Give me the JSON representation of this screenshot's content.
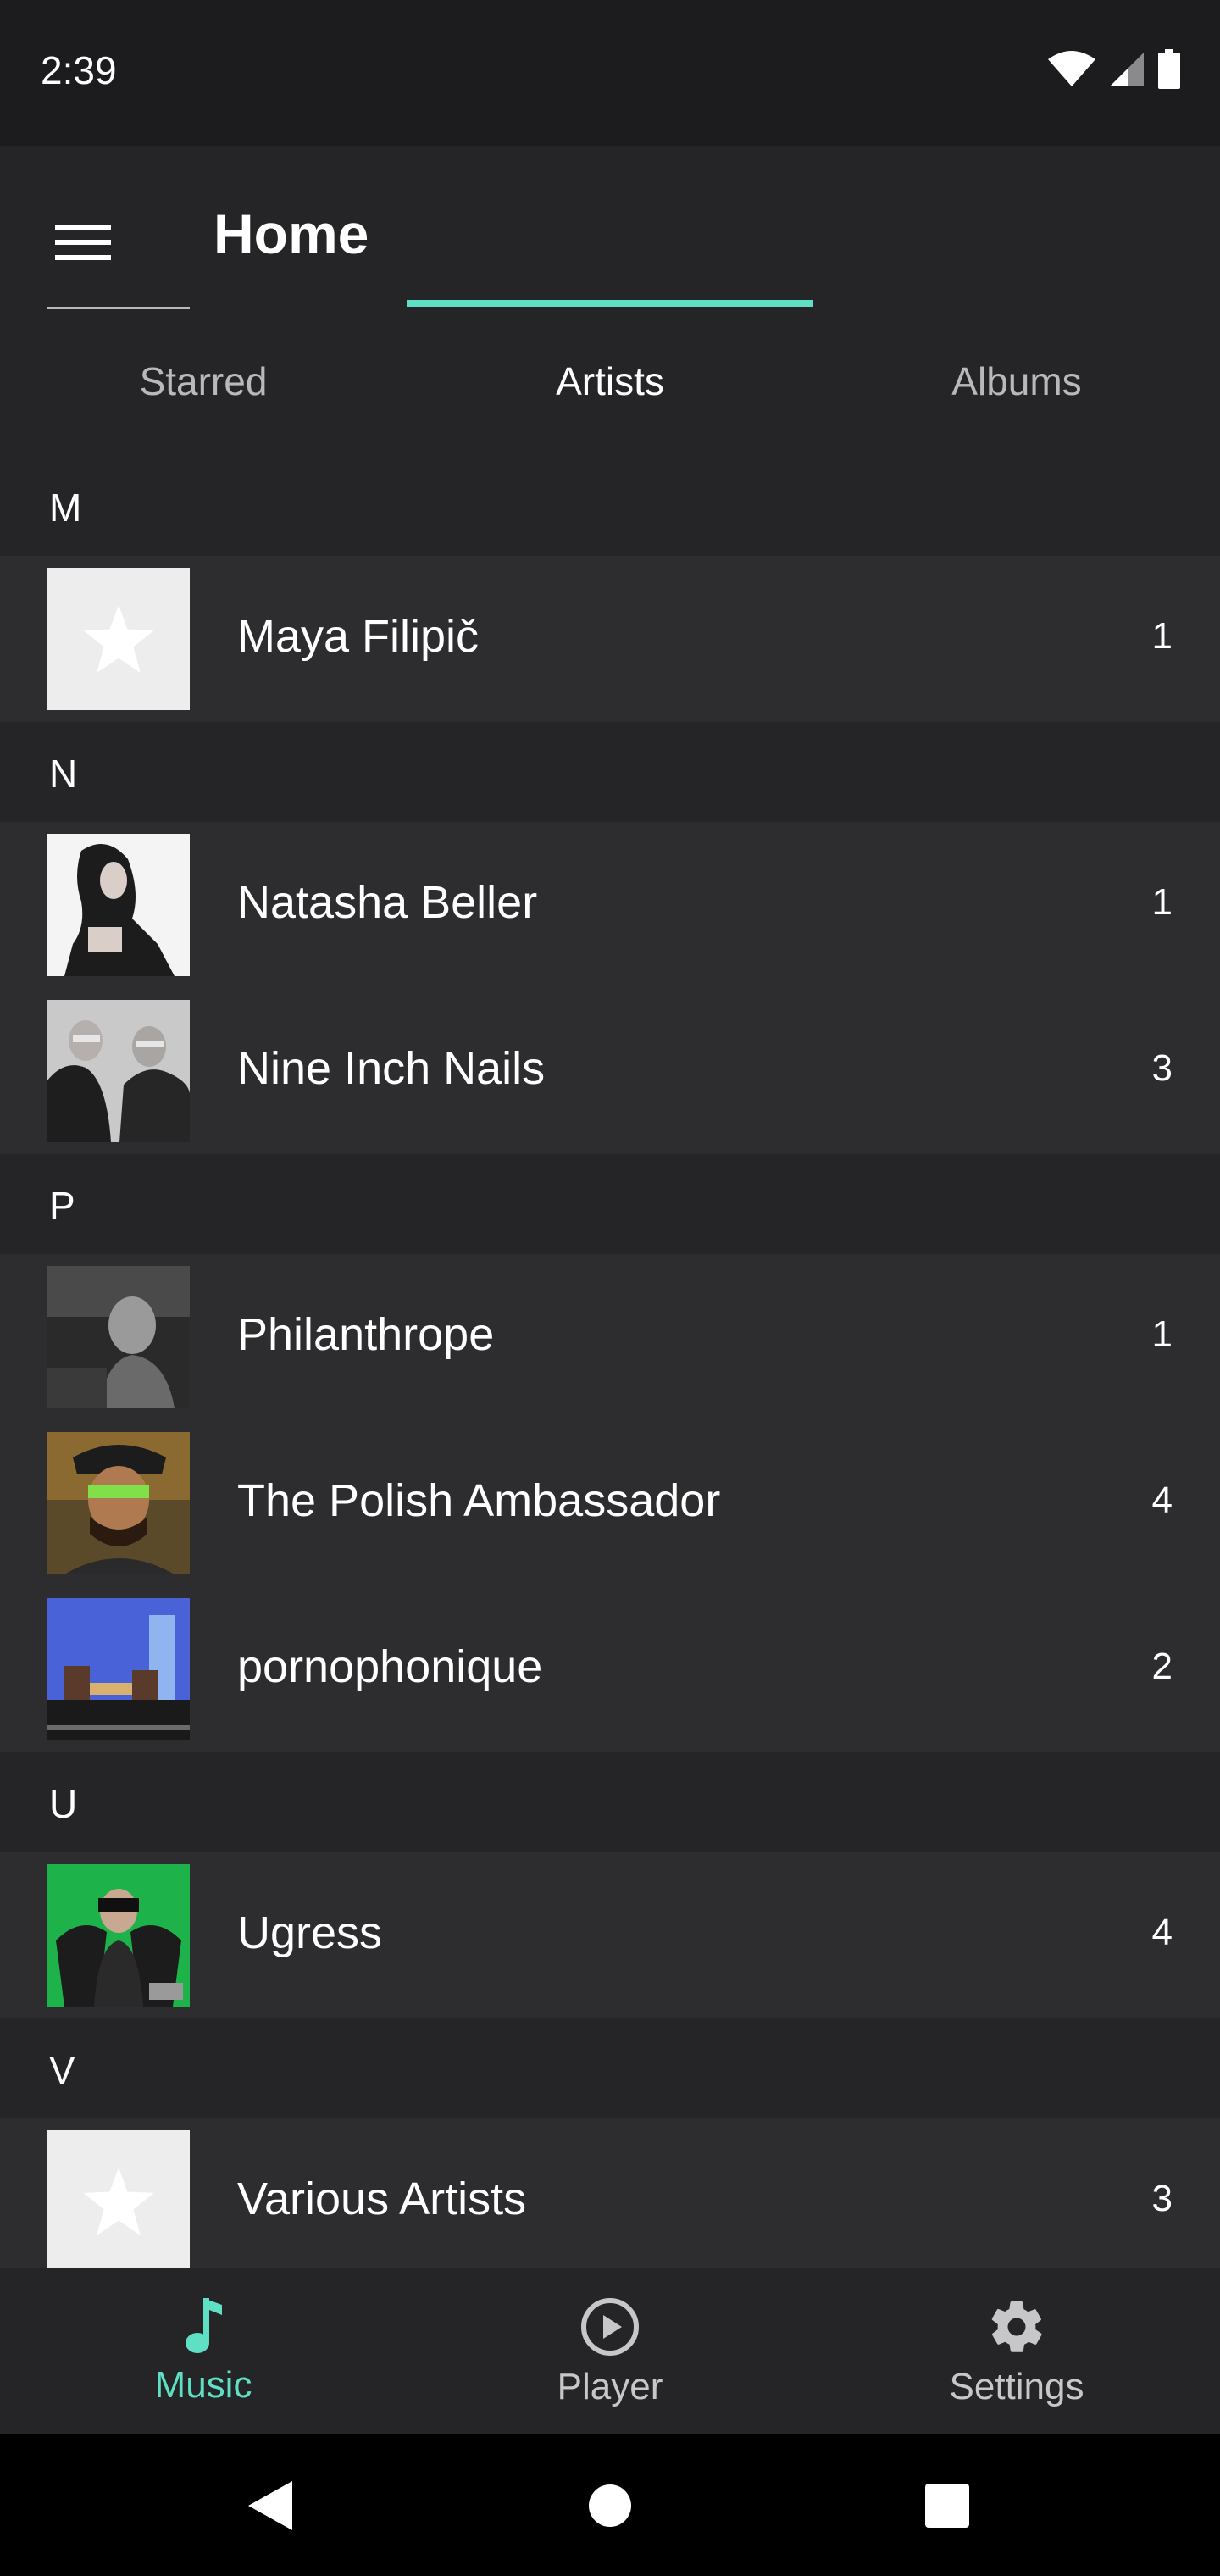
{
  "status_bar": {
    "time": "2:39"
  },
  "app_bar": {
    "title": "Home"
  },
  "tabs": [
    {
      "label": "Starred"
    },
    {
      "label": "Artists"
    },
    {
      "label": "Albums"
    }
  ],
  "sections": [
    {
      "letter": "M",
      "artists": [
        {
          "name": "Maya Filipič",
          "count": "1"
        }
      ]
    },
    {
      "letter": "N",
      "artists": [
        {
          "name": "Natasha Beller",
          "count": "1"
        },
        {
          "name": "Nine Inch Nails",
          "count": "3"
        }
      ]
    },
    {
      "letter": "P",
      "artists": [
        {
          "name": "Philanthrope",
          "count": "1"
        },
        {
          "name": "The Polish Ambassador",
          "count": "4"
        },
        {
          "name": "pornophonique",
          "count": "2"
        }
      ]
    },
    {
      "letter": "U",
      "artists": [
        {
          "name": "Ugress",
          "count": "4"
        }
      ]
    },
    {
      "letter": "V",
      "artists": [
        {
          "name": "Various Artists",
          "count": "3"
        }
      ]
    }
  ],
  "bottom_nav": [
    {
      "label": "Music",
      "icon": "music-note-icon"
    },
    {
      "label": "Player",
      "icon": "play-circle-icon"
    },
    {
      "label": "Settings",
      "icon": "gear-icon"
    }
  ],
  "colors": {
    "accent": "#5fe0c4",
    "background": "#2d2d2f",
    "header": "#252527"
  }
}
